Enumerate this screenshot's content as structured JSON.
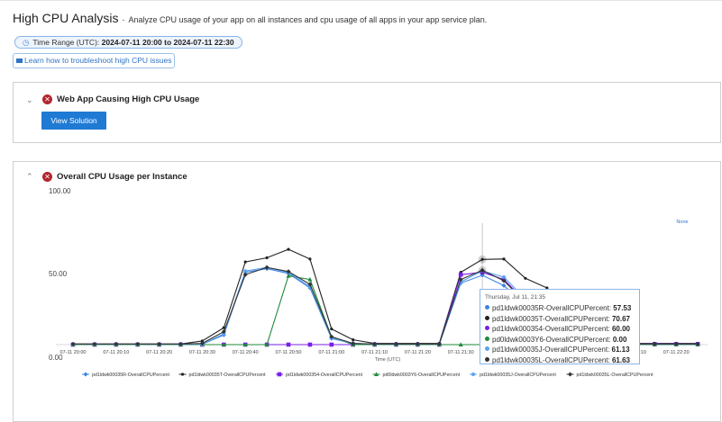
{
  "header": {
    "title": "High CPU Analysis",
    "separator": "-",
    "description": "Analyze CPU usage of your app on all instances and cpu usage of all apps in your app service plan."
  },
  "time_range": {
    "label": "Time Range (UTC):",
    "value": "2024-07-11 20:00 to 2024-07-11 22:30",
    "icon": "clock-icon"
  },
  "learn_link": {
    "label": "Learn how to troubleshoot high CPU issues",
    "icon": "video-camera-icon"
  },
  "panel_solution": {
    "title": "Web App Causing High CPU Usage",
    "button": "View Solution",
    "status_icon": "error-icon",
    "collapsed": true
  },
  "panel_cpu": {
    "title": "Overall CPU Usage per Instance",
    "status_icon": "error-icon",
    "collapsed": false
  },
  "colors": {
    "accent": "#1f7ad4",
    "error": "#b3262e"
  },
  "chart_data": {
    "type": "line",
    "xlabel": "Time (UTC)",
    "ylabel": "",
    "ylim": [
      0,
      100
    ],
    "y_tick_labels": [
      "100.00",
      "50.00",
      "0.00"
    ],
    "x_tick_labels": [
      "07-11 20:00",
      "07-11 20:10",
      "07-11 20:20",
      "07-11 20:30",
      "07-11 20:40",
      "07-11 20:50",
      "07-11 21:00",
      "07-11 21:10",
      "07-11 21:20",
      "07-11 21:30",
      "07-11 21:40",
      "07-11 21:50",
      "07-11 22:00",
      "07-11 22:10",
      "07-11 22:20"
    ],
    "x": [
      "20:00",
      "20:05",
      "20:10",
      "20:15",
      "20:20",
      "20:25",
      "20:30",
      "20:35",
      "20:40",
      "20:45",
      "20:50",
      "20:55",
      "21:00",
      "21:05",
      "21:10",
      "21:15",
      "21:20",
      "21:25",
      "21:30",
      "21:35",
      "21:40",
      "21:45",
      "21:50",
      "21:55",
      "22:00",
      "22:05",
      "22:10",
      "22:15",
      "22:20",
      "22:25"
    ],
    "series": [
      {
        "name": "pd1ldwk00035R-OverallCPUPercent",
        "color": "#3d84e0",
        "marker": "diamond",
        "values": [
          0.3,
          0.3,
          0.3,
          0.3,
          0.3,
          0.3,
          0.3,
          8,
          60,
          63,
          59,
          47,
          5,
          1,
          0.3,
          0.3,
          0.3,
          0.3,
          51,
          57.53,
          49,
          33,
          12,
          0.3,
          0.3,
          0.3,
          0.3,
          0.3,
          0.3,
          0.3
        ]
      },
      {
        "name": "pd1ldwk00035T-OverallCPUPercent",
        "color": "#222222",
        "marker": "plus",
        "values": [
          0.5,
          0.5,
          0.5,
          0.5,
          0.5,
          0.5,
          3,
          14,
          68.6,
          72,
          79,
          71,
          13,
          4,
          1,
          1,
          1,
          1,
          60,
          70.67,
          71,
          55,
          47,
          10,
          1,
          1,
          1,
          1,
          1,
          1
        ]
      },
      {
        "name": "pd1ldwk000354-OverallCPUPercent",
        "color": "#7a1fe8",
        "marker": "square",
        "values": [
          0,
          0,
          0,
          0,
          0,
          0,
          0,
          0,
          0,
          0,
          0,
          0,
          0,
          0,
          0,
          0,
          0,
          0,
          58,
          60.0,
          54,
          36,
          14,
          0.5,
          0.5,
          0.5,
          0.5,
          0.5,
          0.5,
          0.5
        ]
      },
      {
        "name": "pd0ldwk0003Y6-OverallCPUPercent",
        "color": "#1e8a3a",
        "marker": "triangle",
        "values": [
          0,
          0,
          0,
          0,
          0,
          0,
          0,
          0,
          0,
          0,
          57,
          54,
          6.5,
          0,
          0,
          0,
          0,
          0,
          0,
          0.0,
          0,
          0,
          0,
          0,
          0,
          0,
          0,
          0,
          0,
          0
        ]
      },
      {
        "name": "pd1ldwk00035J-OverallCPUPercent",
        "color": "#5aa2f2",
        "marker": "star",
        "values": [
          0.3,
          0.3,
          0.3,
          0.3,
          0.3,
          0.3,
          0.3,
          9,
          61,
          64,
          60,
          48,
          5.5,
          1,
          0.3,
          0.3,
          0.3,
          0.3,
          52,
          61.13,
          56,
          38,
          14,
          0.3,
          0.3,
          0.3,
          0.3,
          0.3,
          0.3,
          0.3
        ]
      },
      {
        "name": "pd1ldwk00035L-OverallCPUPercent",
        "color": "#333333",
        "marker": "diamond",
        "values": [
          0.5,
          0.5,
          0.5,
          0.5,
          0.5,
          0.5,
          1,
          10.7,
          58,
          64,
          60.6,
          50,
          6.5,
          1,
          0.5,
          0.5,
          0.5,
          0.5,
          54,
          61.63,
          53,
          35,
          15,
          0.5,
          0.5,
          0.5,
          0.5,
          0.5,
          0.5,
          0.5
        ]
      }
    ],
    "legend_position": "bottom",
    "reset_zoom_label": "None",
    "tooltip": {
      "header": "Thursday, Jul 11, 21:35",
      "rows": [
        {
          "name": "pd1ldwk00035R-OverallCPUPercent",
          "value": "57.53"
        },
        {
          "name": "pd1ldwk00035T-OverallCPUPercent",
          "value": "70.67"
        },
        {
          "name": "pd1ldwk000354-OverallCPUPercent",
          "value": "60.00"
        },
        {
          "name": "pd0ldwk0003Y6-OverallCPUPercent",
          "value": "0.00"
        },
        {
          "name": "pd1ldwk00035J-OverallCPUPercent",
          "value": "61.13"
        },
        {
          "name": "pd1ldwk00035L-OverallCPUPercent",
          "value": "61.63"
        }
      ]
    }
  }
}
